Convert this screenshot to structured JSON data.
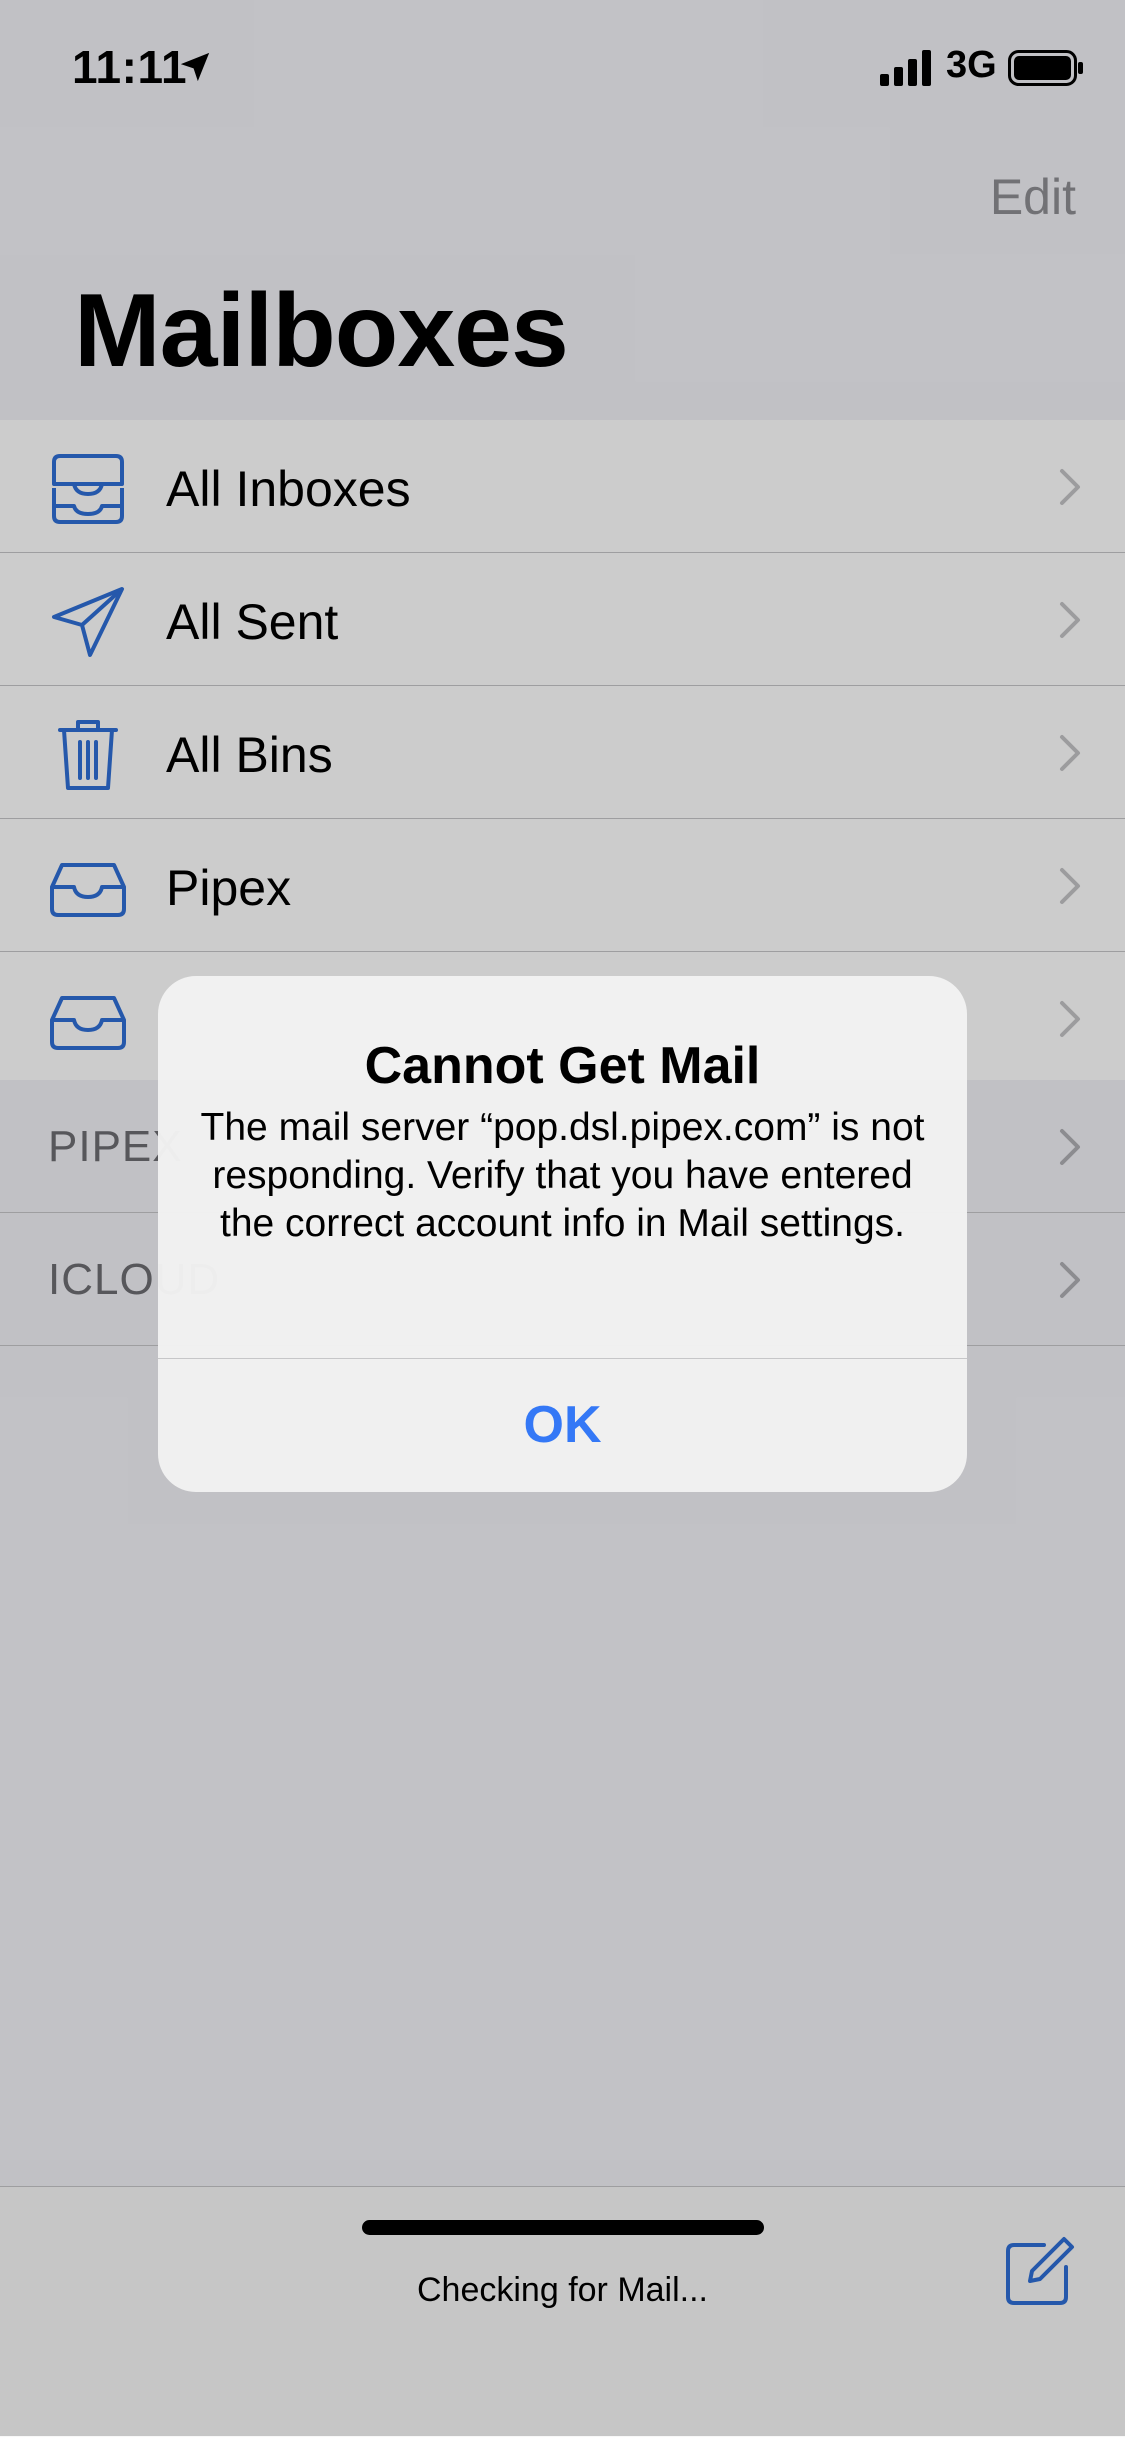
{
  "status_bar": {
    "time": "11:11",
    "network": "3G"
  },
  "header": {
    "edit_label": "Edit",
    "title": "Mailboxes"
  },
  "mailboxes": [
    {
      "label": "All Inboxes",
      "icon": "tray-stack-icon"
    },
    {
      "label": "All Sent",
      "icon": "paper-plane-icon"
    },
    {
      "label": "All Bins",
      "icon": "trash-icon"
    },
    {
      "label": "Pipex",
      "icon": "inbox-tray-icon"
    },
    {
      "label": "",
      "icon": "inbox-tray-icon"
    }
  ],
  "sections": [
    {
      "label": "PIPEX"
    },
    {
      "label": "ICLOUD"
    }
  ],
  "toolbar": {
    "status_text": "Checking for Mail..."
  },
  "alert": {
    "title": "Cannot Get Mail",
    "message": "The mail server “pop.dsl.pipex.com” is not responding. Verify that you have entered the correct account info in Mail settings.",
    "ok_label": "OK"
  },
  "colors": {
    "accent": "#3478f6",
    "icon_blue": "#2f6fd6"
  }
}
